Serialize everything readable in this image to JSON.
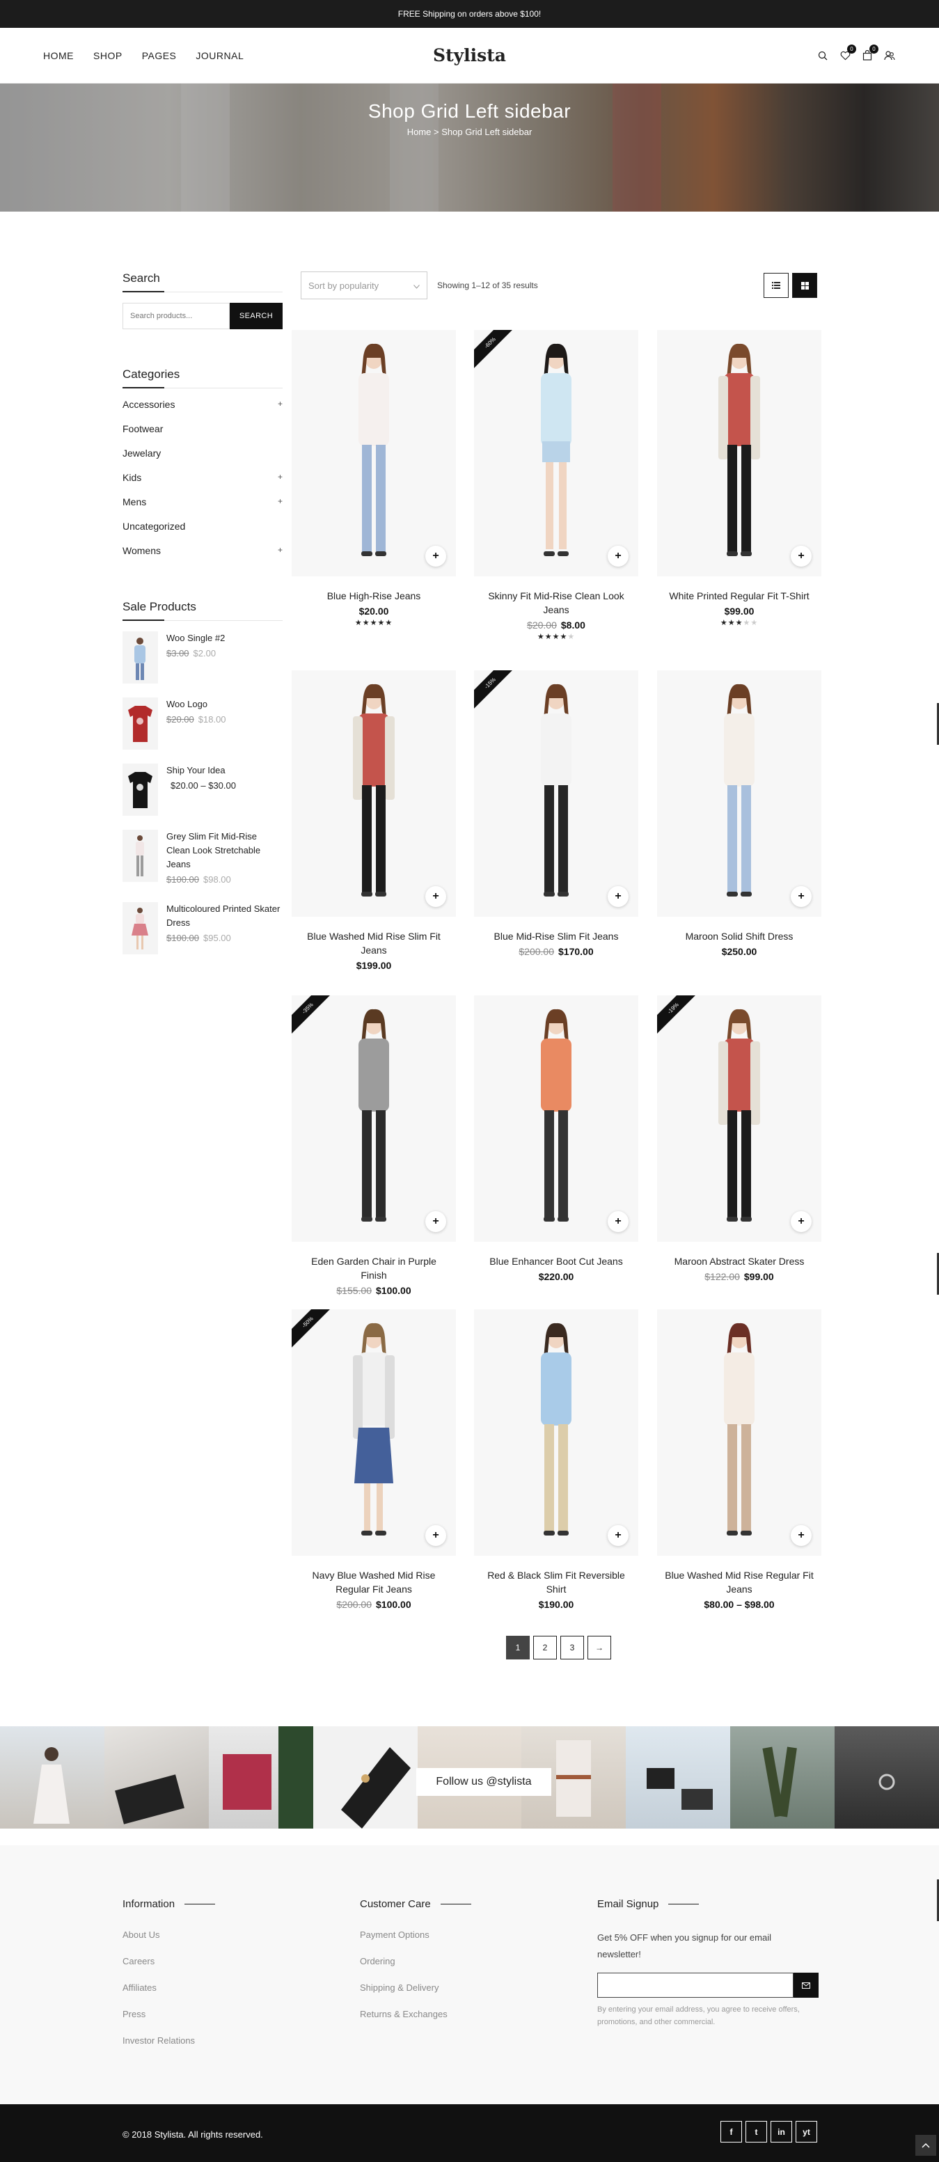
{
  "topbar": {
    "text": "FREE Shipping on orders above $100!"
  },
  "nav": [
    "HOME",
    "SHOP",
    "PAGES",
    "JOURNAL"
  ],
  "logo": "Stylista",
  "header_icons": {
    "wishlist_count": "0",
    "cart_count": "0"
  },
  "hero": {
    "title": "Shop Grid Left sidebar",
    "crumb_home": "Home",
    "crumb_sep": ">",
    "crumb_current": "Shop Grid Left sidebar"
  },
  "sidebar": {
    "search_title": "Search",
    "search_placeholder": "Search products...",
    "search_button": "SEARCH",
    "categories_title": "Categories",
    "categories": [
      {
        "label": "Accessories",
        "expand": "+"
      },
      {
        "label": "Footwear",
        "expand": ""
      },
      {
        "label": "Jewelary",
        "expand": ""
      },
      {
        "label": "Kids",
        "expand": "+"
      },
      {
        "label": "Mens",
        "expand": "+"
      },
      {
        "label": "Uncategorized",
        "expand": ""
      },
      {
        "label": "Womens",
        "expand": "+"
      }
    ],
    "sale_title": "Sale Products",
    "sale_products": [
      {
        "name": "Woo Single #2",
        "old": "$3.00",
        "price": "$2.00"
      },
      {
        "name": "Woo Logo",
        "old": "$20.00",
        "price": "$18.00"
      },
      {
        "name": "Ship Your Idea",
        "old": "",
        "price": "$20.00 – $30.00"
      },
      {
        "name": "Grey Slim Fit Mid-Rise Clean Look Stretchable Jeans",
        "old": "$100.00",
        "price": "$98.00"
      },
      {
        "name": "Multicoloured Printed Skater Dress",
        "old": "$100.00",
        "price": "$95.00"
      }
    ]
  },
  "toolbar": {
    "sort": "Sort by popularity",
    "showing": "Showing 1–12 of 35 results"
  },
  "products": [
    {
      "title": "Blue High-Rise Jeans",
      "old": "",
      "price": "$20.00",
      "badge": "",
      "rating": 5
    },
    {
      "title": "Skinny Fit Mid-Rise Clean Look Jeans",
      "old": "$20.00",
      "price": "$8.00",
      "badge": "-60%",
      "rating": 4
    },
    {
      "title": "White Printed Regular Fit T-Shirt",
      "old": "",
      "price": "$99.00",
      "badge": "",
      "rating": 3
    },
    {
      "title": "Blue Washed Mid Rise Slim Fit Jeans",
      "old": "",
      "price": "$199.00",
      "badge": "",
      "rating": 0
    },
    {
      "title": "Blue Mid-Rise Slim Fit Jeans",
      "old": "$200.00",
      "price": "$170.00",
      "badge": "-15%",
      "rating": 0
    },
    {
      "title": "Maroon Solid Shift Dress",
      "old": "",
      "price": "$250.00",
      "badge": "",
      "rating": 0
    },
    {
      "title": "Eden Garden Chair in Purple Finish",
      "old": "$155.00",
      "price": "$100.00",
      "badge": "-35%",
      "rating": 0
    },
    {
      "title": "Blue Enhancer Boot Cut Jeans",
      "old": "",
      "price": "$220.00",
      "badge": "",
      "rating": 0
    },
    {
      "title": "Maroon Abstract Skater Dress",
      "old": "$122.00",
      "price": "$99.00",
      "badge": "-19%",
      "rating": 0
    },
    {
      "title": "Navy Blue Washed Mid Rise Regular Fit Jeans",
      "old": "$200.00",
      "price": "$100.00",
      "badge": "-50%",
      "rating": 0
    },
    {
      "title": "Red & Black Slim Fit Reversible Shirt",
      "old": "",
      "price": "$190.00",
      "badge": "",
      "rating": 0
    },
    {
      "title": "Blue Washed Mid Rise Regular Fit Jeans",
      "old": "",
      "price": "$80.00 – $98.00",
      "badge": "",
      "rating": 0
    }
  ],
  "add_label": "+",
  "pagination": [
    "1",
    "2",
    "3",
    "→"
  ],
  "instagram": {
    "follow": "Follow us @stylista"
  },
  "footer": {
    "info_title": "Information",
    "info_links": [
      "About Us",
      "Careers",
      "Affiliates",
      "Press",
      "Investor Relations"
    ],
    "care_title": "Customer Care",
    "care_links": [
      "Payment Options",
      "Ordering",
      "Shipping & Delivery",
      "Returns & Exchanges"
    ],
    "email_title": "Email Signup",
    "email_text": "Get 5% OFF when you signup for our email newsletter!",
    "email_note": "By entering your email address, you agree to receive offers, promotions, and other commercial."
  },
  "bottom": {
    "copyright": "© 2018 Stylista. All rights reserved.",
    "social": [
      "f",
      "t",
      "in",
      "yt"
    ]
  }
}
